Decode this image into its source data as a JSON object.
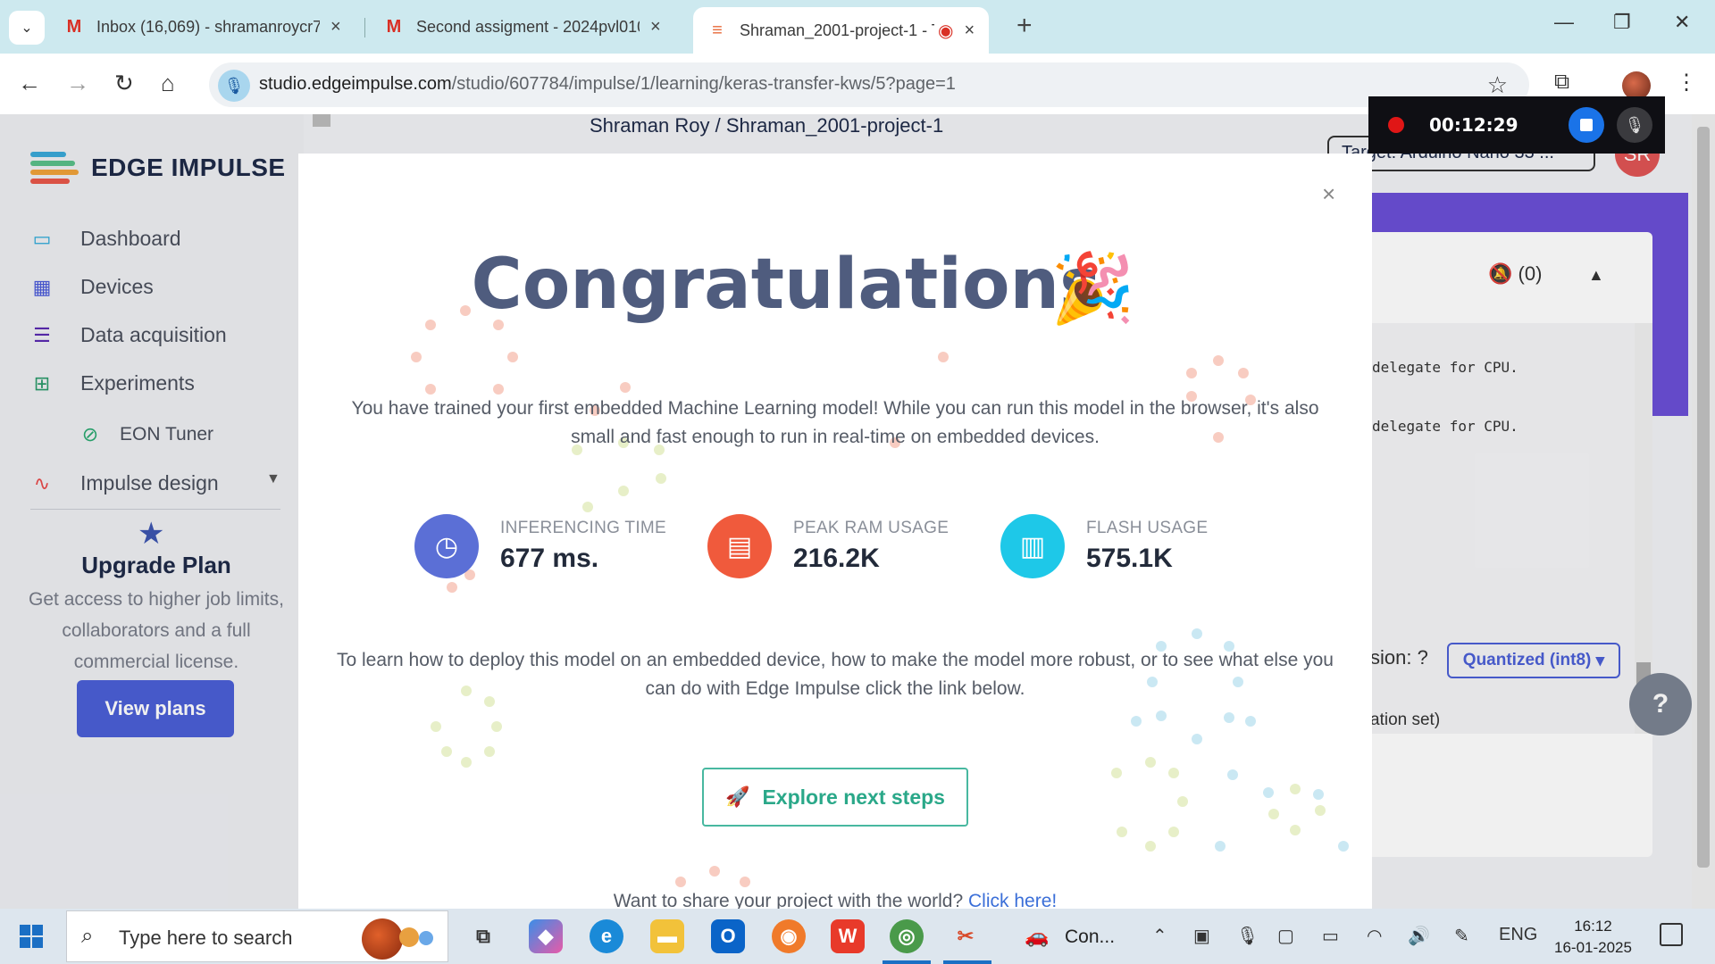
{
  "browser": {
    "tabs": [
      {
        "label": "Inbox (16,069) - shramanroycr7",
        "icon": "gmail-icon",
        "active": false
      },
      {
        "label": "Second assigment - 2024pvl010",
        "icon": "gmail-icon",
        "active": false
      },
      {
        "label": "Shraman_2001-project-1 - T",
        "icon": "edge-impulse-icon",
        "active": true
      }
    ],
    "url_host": "studio.edgeimpulse.com",
    "url_path": "/studio/607784/impulse/1/learning/keras-transfer-kws/5?page=1"
  },
  "recorder": {
    "time": "00:12:29"
  },
  "sidebar": {
    "brand": "EDGE IMPULSE",
    "items": [
      {
        "label": "Dashboard",
        "icon": "monitor-icon"
      },
      {
        "label": "Devices",
        "icon": "chip-icon"
      },
      {
        "label": "Data acquisition",
        "icon": "database-icon"
      },
      {
        "label": "Experiments",
        "icon": "table-icon"
      },
      {
        "label": "EON Tuner",
        "icon": "compass-icon"
      },
      {
        "label": "Impulse design",
        "icon": "pulse-icon"
      }
    ],
    "upgrade": {
      "title": "Upgrade Plan",
      "text": "Get access to higher job limits, collaborators and a full commercial license.",
      "button": "View plans"
    }
  },
  "page": {
    "breadcrumb": "Shraman Roy  /  Shraman_2001-project-1",
    "target": "Target: Arduino Nano 33 ...",
    "avatar": "SR",
    "notifications": "(0)",
    "log_lines": [
      "delegate for CPU.",
      "delegate for CPU."
    ],
    "version_label": "sion:",
    "quantized": "Quantized (int8)",
    "validation": "ation set)"
  },
  "modal": {
    "title": "Congratulations",
    "intro": "You have trained your first embedded Machine Learning model! While you can run this model in the browser, it's also small and fast enough to run in real-time on embedded devices.",
    "stats": [
      {
        "label": "INFERENCING TIME",
        "value": "677 ms.",
        "color": "#5b6fd6",
        "icon": "clock-icon"
      },
      {
        "label": "PEAK RAM USAGE",
        "value": "216.2K",
        "color": "#f05a3c",
        "icon": "ram-icon"
      },
      {
        "label": "FLASH USAGE",
        "value": "575.1K",
        "color": "#1ec8e8",
        "icon": "flash-chip-icon"
      }
    ],
    "deploy_text": "To learn how to deploy this model on an embedded device, how to make the model more robust, or to see what else you can do with Edge Impulse click the link below.",
    "explore_button": "Explore next steps",
    "share_prefix": "Want to share your project with the world? ",
    "share_link": "Click here!"
  },
  "taskbar": {
    "search_placeholder": "Type here to search",
    "app_label": "Con...",
    "lang": "ENG",
    "time": "16:12",
    "date": "16-01-2025"
  }
}
